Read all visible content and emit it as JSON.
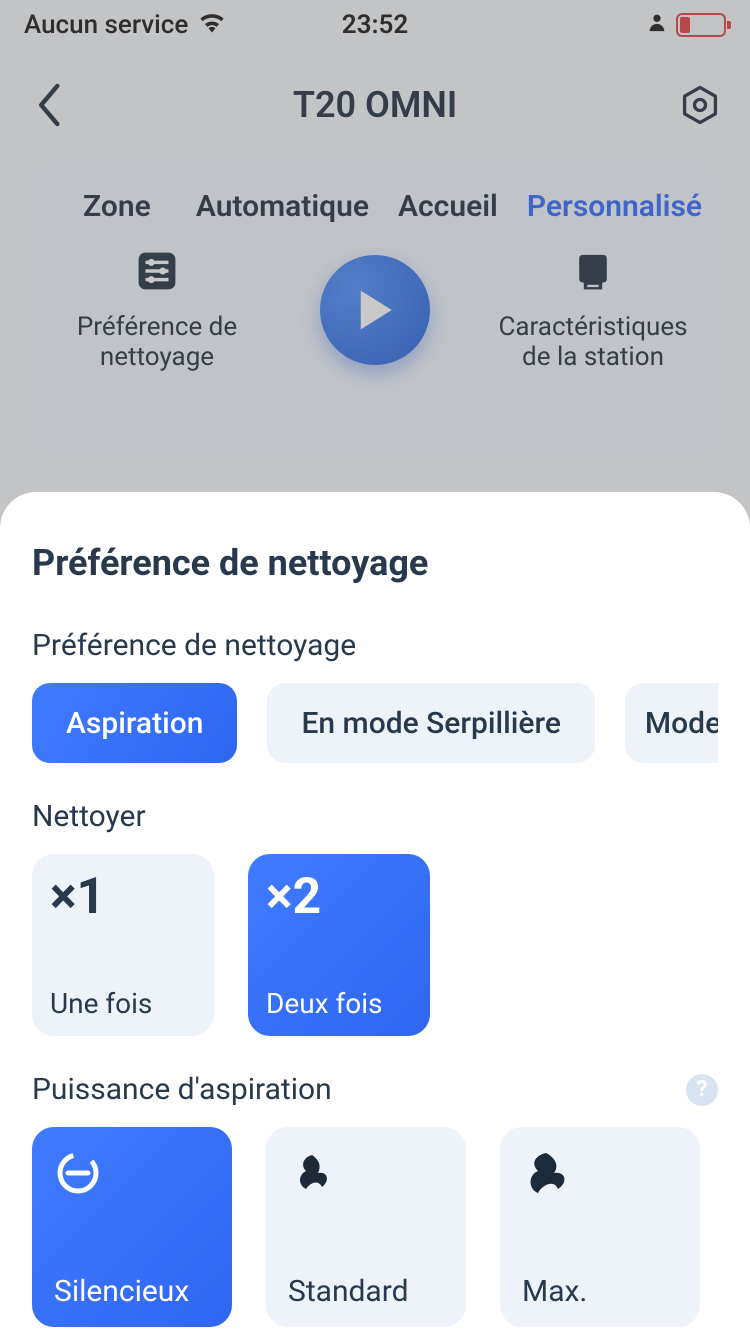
{
  "status": {
    "service": "Aucun service",
    "time": "23:52"
  },
  "header": {
    "title": "T20 OMNI"
  },
  "tabs": {
    "zone": "Zone",
    "auto": "Automatique",
    "home": "Accueil",
    "custom": "Personnalisé"
  },
  "card": {
    "cleaning_pref": "Préférence de nettoyage",
    "station": "Caractéristiques de la station"
  },
  "sheet": {
    "title": "Préférence de nettoyage",
    "mode_label": "Préférence de nettoyage",
    "modes": {
      "vacuum": "Aspiration",
      "mop": "En mode Serpillière",
      "combo": "Mode asp"
    },
    "clean_label": "Nettoyer",
    "clean_options": {
      "once_big": "×1",
      "once_label": "Une fois",
      "twice_big": "×2",
      "twice_label": "Deux fois"
    },
    "power_label": "Puissance d'aspiration",
    "power_help": "?",
    "power_options": {
      "quiet": "Silencieux",
      "standard": "Standard",
      "max": "Max."
    }
  }
}
